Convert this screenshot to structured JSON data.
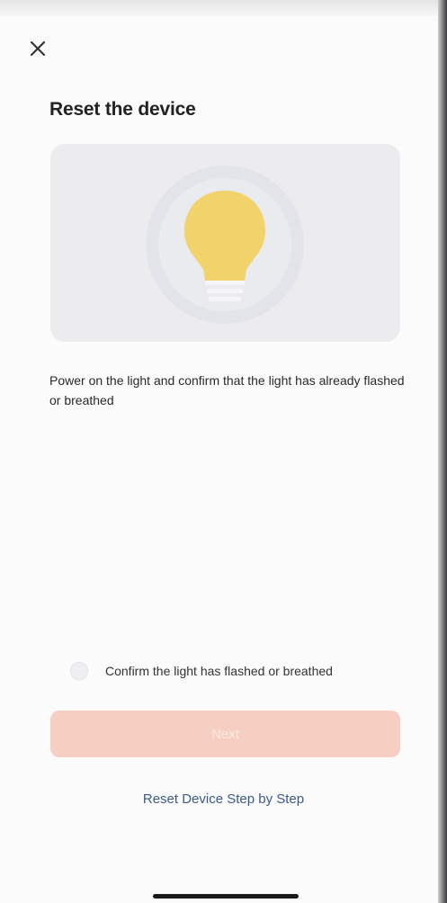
{
  "header": {
    "close_icon": "close-icon",
    "title": "Reset the device"
  },
  "illustration": {
    "icon": "light-bulb-icon",
    "bulb_color": "#f2d26a"
  },
  "instruction": "Power on the light and confirm that the light has already flashed or breathed",
  "confirm": {
    "label": "Confirm the light has flashed or breathed",
    "checked": false
  },
  "next_button": {
    "label": "Next",
    "enabled": false,
    "color": "#f6cfc2"
  },
  "step_link": {
    "label": "Reset Device Step by Step",
    "color": "#3a5a8a"
  }
}
